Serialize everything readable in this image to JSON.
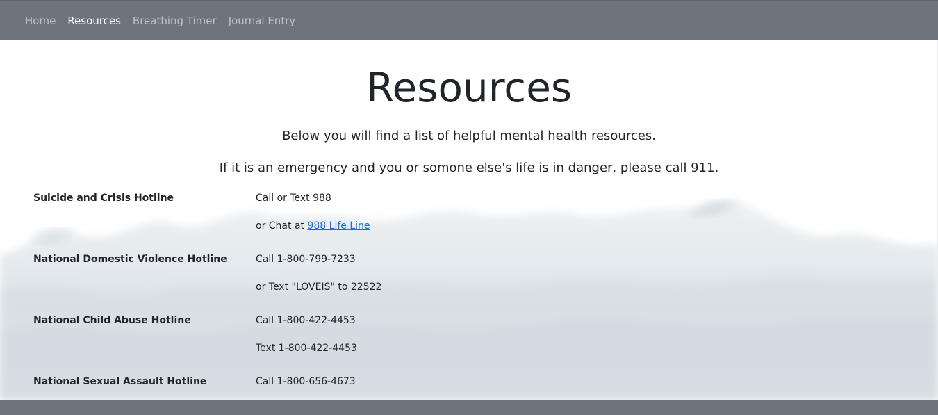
{
  "nav": {
    "items": [
      {
        "label": "Home"
      },
      {
        "label": "Resources"
      },
      {
        "label": "Breathing Timer"
      },
      {
        "label": "Journal Entry"
      }
    ],
    "active": "Resources"
  },
  "page": {
    "title": "Resources",
    "intro": "Below you will find a list of helpful mental health resources.",
    "emergency": "If it is an emergency and you or somone else's life is in danger, please call 911."
  },
  "resources": [
    {
      "name": "Suicide and Crisis Hotline",
      "line1": "Call or Text 988",
      "line2_prefix": "or Chat at ",
      "line2_link": "988 Life Line"
    },
    {
      "name": "National Domestic Violence Hotline",
      "line1": "Call 1-800-799-7233",
      "line2": "or Text \"LOVEIS\" to 22522"
    },
    {
      "name": "National Child Abuse Hotline",
      "line1": "Call 1-800-422-4453",
      "line2": "Text 1-800-422-4453"
    },
    {
      "name": "National Sexual Assault Hotline",
      "line1": "Call 1-800-656-4673"
    }
  ],
  "colors": {
    "navbar": "#6c757d",
    "link": "#0d6efd",
    "text": "#212529"
  }
}
